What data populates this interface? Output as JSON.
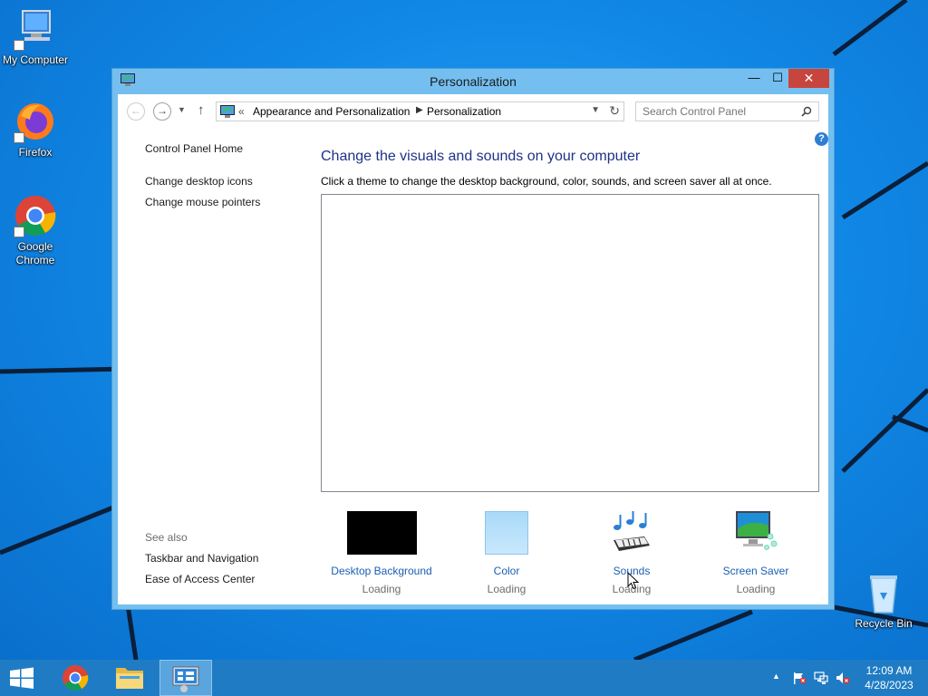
{
  "desktop": {
    "icons": [
      {
        "label": "My Computer"
      },
      {
        "label": "Firefox"
      },
      {
        "label": "Google Chrome"
      },
      {
        "label": "Recycle Bin"
      }
    ]
  },
  "window": {
    "title": "Personalization",
    "controls": {
      "minimize": "—",
      "maximize": "☐",
      "close": "✕"
    },
    "address": {
      "chevron": "«",
      "crumbs": [
        "Appearance and Personalization",
        "Personalization"
      ],
      "separator": "▶"
    },
    "search": {
      "placeholder": "Search Control Panel"
    },
    "help": "?",
    "left_pane": {
      "home": "Control Panel Home",
      "links": [
        "Change desktop icons",
        "Change mouse pointers"
      ],
      "see_also_header": "See also",
      "see_also": [
        "Taskbar and Navigation",
        "Ease of Access Center"
      ]
    },
    "main": {
      "heading": "Change the visuals and sounds on your computer",
      "description": "Click a theme to change the desktop background, color, sounds, and screen saver all at once.",
      "items": [
        {
          "label": "Desktop Background",
          "status": "Loading",
          "icon": "desktop-background-thumbnail"
        },
        {
          "label": "Color",
          "status": "Loading",
          "icon": "color-swatch"
        },
        {
          "label": "Sounds",
          "status": "Loading",
          "icon": "sounds-icon"
        },
        {
          "label": "Screen Saver",
          "status": "Loading",
          "icon": "screen-saver-icon"
        }
      ]
    }
  },
  "taskbar": {
    "clock": {
      "time": "12:09 AM",
      "date": "4/28/2023"
    },
    "tray_arrow": "▲"
  },
  "colors": {
    "accent": "#1f7cc4",
    "window_frame": "#74bff0",
    "close_button": "#c7453d",
    "link": "#1a5fb4",
    "heading": "#1e3287"
  }
}
